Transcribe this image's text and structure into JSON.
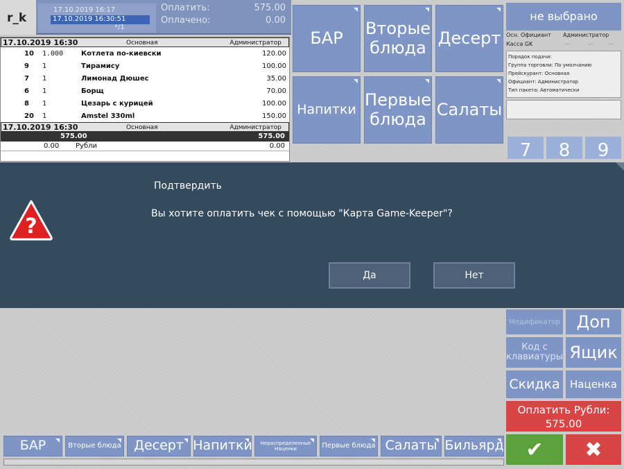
{
  "header": {
    "logo": "r_k",
    "date1": "17.10.2019 16:17",
    "date2": "17.10.2019 16:30:51",
    "guests": "*/1",
    "to_pay_label": "Оплатить:",
    "to_pay_value": "575.00",
    "paid_label": "Оплачено:",
    "paid_value": "0.00"
  },
  "check": {
    "header": {
      "date": "17.10.2019 16:30",
      "section": "Основная",
      "role": "Администратор"
    },
    "items": [
      {
        "num": "10",
        "qty": "1.000",
        "name": "Котлета по-киевски",
        "sum": "120.00"
      },
      {
        "num": "9",
        "qty": "1",
        "name": "Тирамису",
        "sum": "100.00"
      },
      {
        "num": "7",
        "qty": "1",
        "name": "Лимонад Дюшес",
        "sum": "35.00"
      },
      {
        "num": "6",
        "qty": "1",
        "name": "Борщ",
        "sum": "70.00"
      },
      {
        "num": "8",
        "qty": "1",
        "name": "Цезарь с курицей",
        "sum": "100.00"
      },
      {
        "num": "20",
        "qty": "1",
        "name": "Amstel 330ml",
        "sum": "150.00"
      }
    ],
    "footer": {
      "date": "17.10.2019 16:30",
      "section": "Основная",
      "role": "Администратор"
    },
    "total_left": "575.00",
    "total_right": "575.00",
    "paid_left": "0.00",
    "paid_currency": "Рубли",
    "paid_right": "0.00"
  },
  "categories": [
    "БАР",
    "Вторые блюда",
    "Десерт",
    "Напитки",
    "Первые блюда",
    "Салаты"
  ],
  "info": {
    "not_selected": "не выбрано",
    "waiter_label": "Осн. Официант",
    "waiter_value": "Администратор",
    "cash_label": "Касса GK",
    "cash_values": [
      "---",
      "---",
      "---"
    ],
    "lines": [
      "Порядок подачи:",
      "Группа торговли: По умолчанию",
      "Прейскурант: Основная",
      "Официант: Администратор",
      "Тип пакета: Автоматически"
    ]
  },
  "numpad": [
    "7",
    "8",
    "9"
  ],
  "dialog": {
    "title": "Подтвердить",
    "message": "Вы хотите оплатить чек с помощью \"Карта Game-Keeper\"?",
    "yes": "Да",
    "no": "Нет"
  },
  "actions": {
    "modifiers": "Модификатор",
    "extra": "Доп",
    "code": "Код с клавиатуры",
    "drawer": "Ящик",
    "discount": "Скидка",
    "markup": "Наценка",
    "pay": "Оплатить Рубли:",
    "pay_amount": "575.00"
  },
  "bottom": [
    "БАР",
    "Вторые блюда",
    "Десерт",
    "Напитки",
    "Нераспределенные Наценки",
    "Первые блюда",
    "Салаты",
    "Бильярд"
  ],
  "colors": {
    "tile": "#7f95c6",
    "dialog": "#344a5e",
    "ok": "#5ba23b",
    "cancel": "#d94545"
  }
}
